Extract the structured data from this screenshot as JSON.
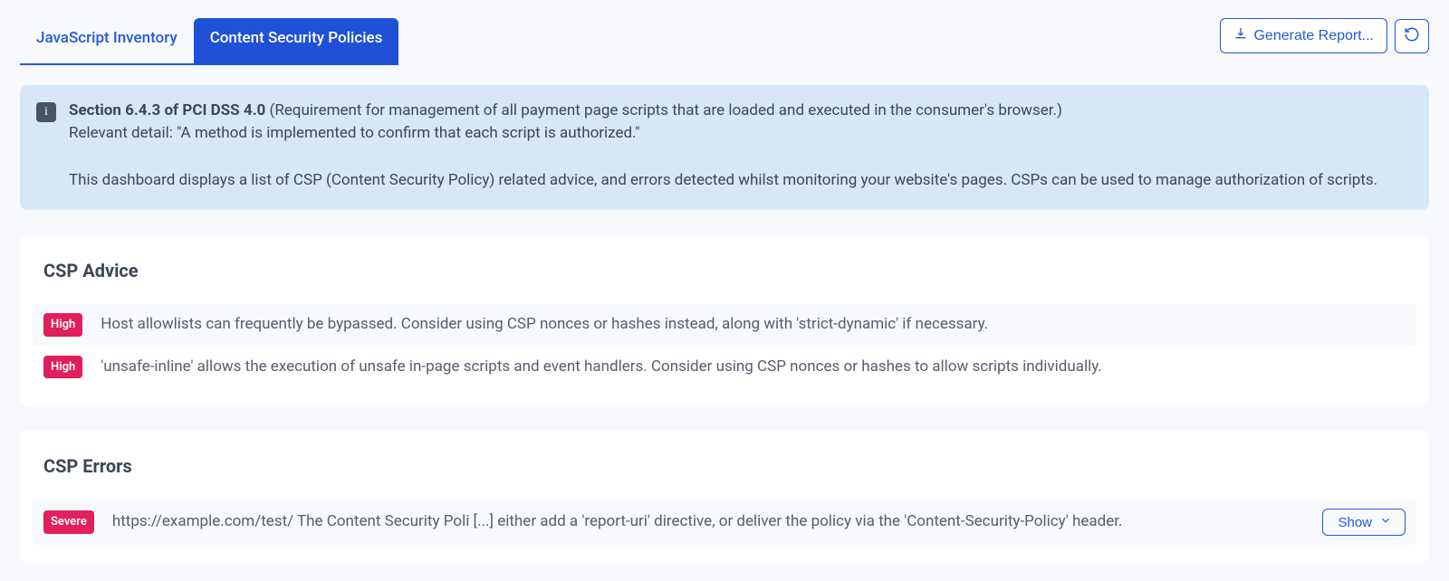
{
  "tabs": {
    "inactive": "JavaScript Inventory",
    "active": "Content Security Policies"
  },
  "actions": {
    "generate_report": "Generate Report..."
  },
  "info": {
    "bold": "Section 6.4.3 of PCI DSS 4.0",
    "rest1": " (Requirement for management of all payment page scripts that are loaded and executed in the consumer's browser.)",
    "detail": "Relevant detail: \"A method is implemented to confirm that each script is authorized.\"",
    "para2": "This dashboard displays a list of CSP (Content Security Policy) related advice, and errors detected whilst monitoring your website's pages. CSPs can be used to manage authorization of scripts."
  },
  "advice": {
    "heading": "CSP Advice",
    "items": [
      {
        "severity": "High",
        "text": "Host allowlists can frequently be bypassed. Consider using CSP nonces or hashes instead, along with 'strict-dynamic' if necessary."
      },
      {
        "severity": "High",
        "text": "'unsafe-inline' allows the execution of unsafe in-page scripts and event handlers. Consider using CSP nonces or hashes to allow scripts individually."
      }
    ]
  },
  "errors": {
    "heading": "CSP Errors",
    "items": [
      {
        "severity": "Severe",
        "text": "https://example.com/test/ The Content Security Poli [...] either add a 'report-uri' directive, or deliver the policy via the 'Content-Security-Policy' header.",
        "show_label": "Show"
      }
    ]
  }
}
